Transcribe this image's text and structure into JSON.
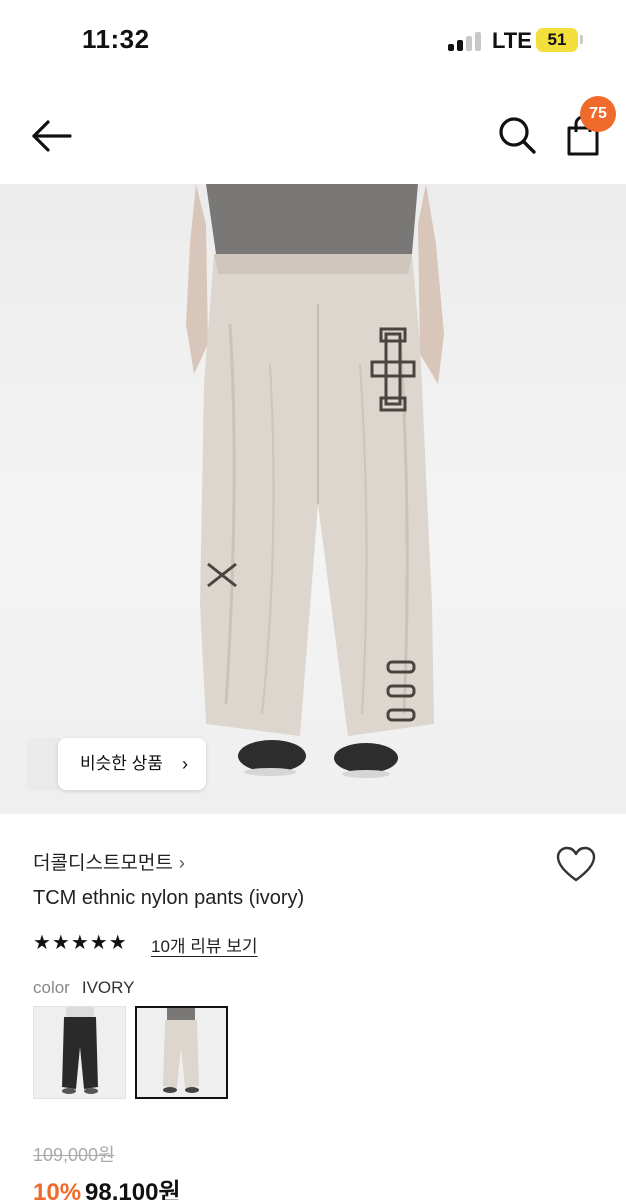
{
  "status_bar": {
    "time": "11:32",
    "network": "LTE",
    "battery": "51",
    "signal_bars_active": 2,
    "signal_bars_total": 4
  },
  "header": {
    "back_icon": "arrow-left-icon",
    "search_icon": "search-icon",
    "cart_icon": "shopping-bag-icon",
    "cart_count": "75"
  },
  "gallery": {
    "similar_products_label": "비슷한 상품",
    "similar_chevron": "›"
  },
  "product": {
    "brand": "더콜디스트모먼트",
    "brand_chevron": "›",
    "name": "TCM ethnic nylon pants (ivory)",
    "stars": "★★★★★",
    "rating": 5,
    "review_link": "10개 리뷰 보기",
    "color_label": "color",
    "color_value": "IVORY",
    "original_price": "109,000원",
    "discount": "10%",
    "sale_price": "98,100원"
  },
  "swatches": [
    {
      "name": "black",
      "selected": false
    },
    {
      "name": "ivory",
      "selected": true
    }
  ],
  "colors": {
    "accent": "#f06a2b",
    "battery": "#f2df3b",
    "text": "#111111",
    "muted": "#888888"
  }
}
